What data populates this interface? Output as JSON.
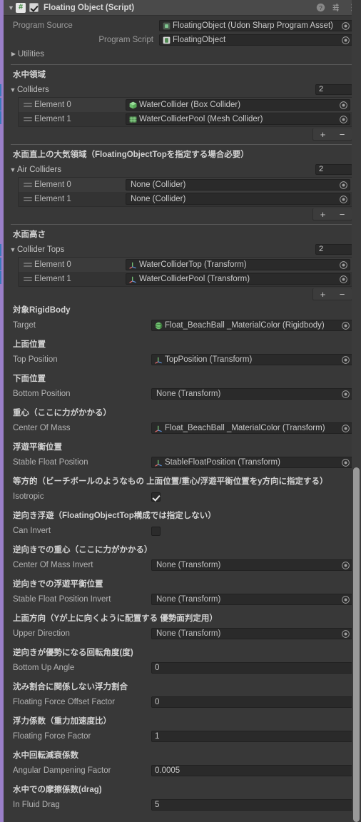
{
  "header": {
    "title": "Floating Object (Script)",
    "foldout": "▼",
    "script_icon": "csharp-script-icon",
    "script_glyph": "#",
    "enabled": true,
    "icons": [
      "help-icon",
      "preset-icon",
      "more-menu-icon"
    ]
  },
  "top_fields": [
    {
      "label": "Program Source",
      "value": "FloatingObject (Udon Sharp Program Asset)",
      "icon": "udon-program-asset-icon",
      "name": "program-source"
    },
    {
      "label": "Program Script",
      "value": "FloatingObject",
      "icon": "script-asset-icon",
      "name": "program-script"
    }
  ],
  "utilities": {
    "label": "Utilities",
    "arrow": "▶"
  },
  "lists": [
    {
      "jp": "水中領域",
      "title": "Colliders",
      "name": "colliders",
      "size": "2",
      "override": true,
      "elements": [
        {
          "label": "Element 0",
          "value": "WaterCollider (Box Collider)",
          "icon": "box-collider-icon"
        },
        {
          "label": "Element 1",
          "value": "WaterColliderPool (Mesh Collider)",
          "icon": "mesh-collider-icon"
        }
      ],
      "add": "+",
      "remove": "−"
    },
    {
      "jp": "水面直上の大気領域（FloatingObjectTopを指定する場合必要）",
      "title": "Air Colliders",
      "name": "air-colliders",
      "size": "2",
      "override": false,
      "elements": [
        {
          "label": "Element 0",
          "value": "None (Collider)",
          "icon": ""
        },
        {
          "label": "Element 1",
          "value": "None (Collider)",
          "icon": ""
        }
      ],
      "add": "+",
      "remove": "−"
    },
    {
      "jp": "水面高さ",
      "title": "Collider Tops",
      "name": "collider-tops",
      "size": "2",
      "override": true,
      "elements": [
        {
          "label": "Element 0",
          "value": "WaterColliderTop (Transform)",
          "icon": "transform-icon"
        },
        {
          "label": "Element 1",
          "value": "WaterColliderPool (Transform)",
          "icon": "transform-icon"
        }
      ],
      "add": "+",
      "remove": "−"
    }
  ],
  "fields": [
    {
      "jp": "対象RigidBody",
      "label": "Target",
      "name": "target",
      "kind": "object",
      "value": "Float_BeachBall _MaterialColor (Rigidbody)",
      "icon": "rigidbody-icon"
    },
    {
      "jp": "上面位置",
      "label": "Top Position",
      "name": "top-position",
      "kind": "object",
      "value": "TopPosition (Transform)",
      "icon": "transform-icon"
    },
    {
      "jp": "下面位置",
      "label": "Bottom Position",
      "name": "bottom-position",
      "kind": "object",
      "value": "None (Transform)",
      "icon": ""
    },
    {
      "jp": "重心（ここに力がかかる）",
      "label": "Center Of Mass",
      "name": "center-of-mass",
      "kind": "object",
      "value": "Float_BeachBall _MaterialColor (Transform)",
      "icon": "transform-icon"
    },
    {
      "jp": "浮遊平衡位置",
      "label": "Stable Float Position",
      "name": "stable-float-position",
      "kind": "object",
      "value": "StableFloatPosition (Transform)",
      "icon": "transform-icon"
    },
    {
      "jp": "等方的（ビーチボールのようなもの 上面位置/重心/浮遊平衡位置をy方向に指定する）",
      "label": "Isotropic",
      "name": "isotropic",
      "kind": "checkbox",
      "value": true
    },
    {
      "jp": "逆向き浮遊（FloatingObjectTop構成では指定しない）",
      "label": "Can Invert",
      "name": "can-invert",
      "kind": "checkbox",
      "value": false
    },
    {
      "jp": "逆向きでの重心（ここに力がかかる）",
      "label": "Center Of Mass Invert",
      "name": "center-of-mass-invert",
      "kind": "object",
      "value": "None (Transform)",
      "icon": ""
    },
    {
      "jp": "逆向きでの浮遊平衡位置",
      "label": "Stable Float Position Invert",
      "name": "stable-float-position-invert",
      "kind": "object",
      "value": "None (Transform)",
      "icon": ""
    },
    {
      "jp": "上面方向（Yが上に向くように配置する 優勢面判定用）",
      "label": "Upper Direction",
      "name": "upper-direction",
      "kind": "object",
      "value": "None (Transform)",
      "icon": ""
    },
    {
      "jp": "逆向きが優勢になる回転角度(度)",
      "label": "Bottom Up Angle",
      "name": "bottom-up-angle",
      "kind": "number",
      "value": "0"
    },
    {
      "jp": "沈み割合に関係しない浮力割合",
      "label": "Floating Force Offset Factor",
      "name": "floating-force-offset-factor",
      "kind": "number",
      "value": "0"
    },
    {
      "jp": "浮力係数（重力加速度比）",
      "label": "Floating Force Factor",
      "name": "floating-force-factor",
      "kind": "number",
      "value": "1"
    },
    {
      "jp": "水中回転減衰係数",
      "label": "Angular Dampening Factor",
      "name": "angular-dampening-factor",
      "kind": "number",
      "value": "0.0005"
    },
    {
      "jp": "水中での摩擦係数(drag)",
      "label": "In Fluid Drag",
      "name": "in-fluid-drag",
      "kind": "number",
      "value": "5"
    }
  ],
  "colors": {
    "panel_bg": "#383838",
    "header_bg": "#4a4a4a",
    "field_bg": "#2a2a2a",
    "prefab_strip": "#9a7fc8",
    "override_bar": "#3a79bb",
    "text": "#c4c4c4"
  }
}
